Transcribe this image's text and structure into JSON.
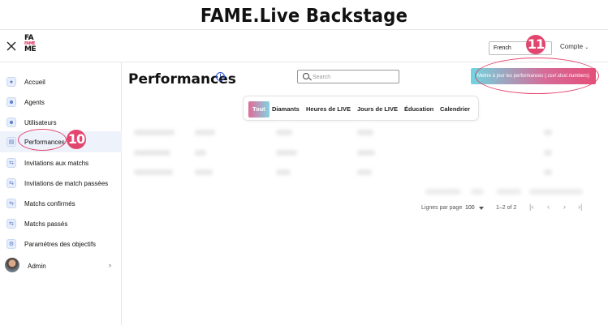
{
  "page_title": "FAME.Live Backstage",
  "logo": {
    "top": "FA",
    "mid": "FAME",
    "bottom": "ME"
  },
  "header": {
    "language": "French",
    "account": "Compte"
  },
  "sidebar": {
    "items": [
      {
        "label": "Accueil",
        "icon": "home-icon"
      },
      {
        "label": "Agents",
        "icon": "user-icon"
      },
      {
        "label": "Utilisateurs",
        "icon": "user-icon"
      },
      {
        "label": "Performances",
        "icon": "chart-icon",
        "active": true
      },
      {
        "label": "Invitations aux matchs",
        "icon": "match-icon"
      },
      {
        "label": "Invitations de match passées",
        "icon": "match-icon"
      },
      {
        "label": "Matchs confirmés",
        "icon": "match-icon"
      },
      {
        "label": "Matchs passés",
        "icon": "match-icon"
      },
      {
        "label": "Paramètres des objectifs",
        "icon": "gear-icon"
      }
    ],
    "user": {
      "name": "Admin"
    }
  },
  "main": {
    "title": "Performances",
    "search_placeholder": "Search",
    "update_button": "Mettre à jour les performances (.csv/.xlsx/.numbers)",
    "tabs": [
      {
        "label": "Tout",
        "active": true
      },
      {
        "label": "Diamants"
      },
      {
        "label": "Heures de LIVE"
      },
      {
        "label": "Jours de LIVE"
      },
      {
        "label": "Éducation"
      },
      {
        "label": "Calendrier"
      }
    ],
    "pagination": {
      "rows_label": "Lignes par page",
      "rows_value": "100",
      "range": "1–2 of 2"
    }
  },
  "callouts": {
    "sidebar": "10",
    "upload": "11"
  },
  "colors": {
    "accent": "#e2456e",
    "gradient_start": "#6fd6e0",
    "link": "#2a4ec9"
  }
}
